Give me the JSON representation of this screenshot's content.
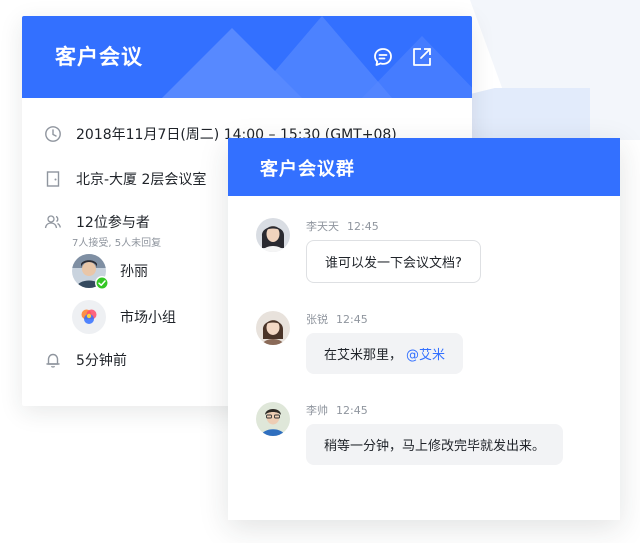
{
  "meeting": {
    "title": "客户会议",
    "time": "2018年11月7日(周二) 14:00 – 15:30 (GMT+08)",
    "location": "北京-大厦 2层会议室",
    "participants_label": "12位参与者",
    "participants_sub": "7人接受, 5人未回复",
    "participants": [
      {
        "name": "孙丽",
        "avatar": "person-avatar"
      },
      {
        "name": "市场小组",
        "avatar": "group-avatar"
      }
    ],
    "reminder": "5分钟前"
  },
  "chat": {
    "title": "客户会议群",
    "messages": [
      {
        "sender": "李天天",
        "time": "12:45",
        "text": "谁可以发一下会议文档?"
      },
      {
        "sender": "张锐",
        "time": "12:45",
        "text": "在艾米那里，",
        "mention": "@艾米"
      },
      {
        "sender": "李帅",
        "time": "12:45",
        "text": "稍等一分钟，马上修改完毕就发出来。"
      }
    ]
  },
  "colors": {
    "brand": "#3370ff",
    "accept": "#34c724"
  }
}
